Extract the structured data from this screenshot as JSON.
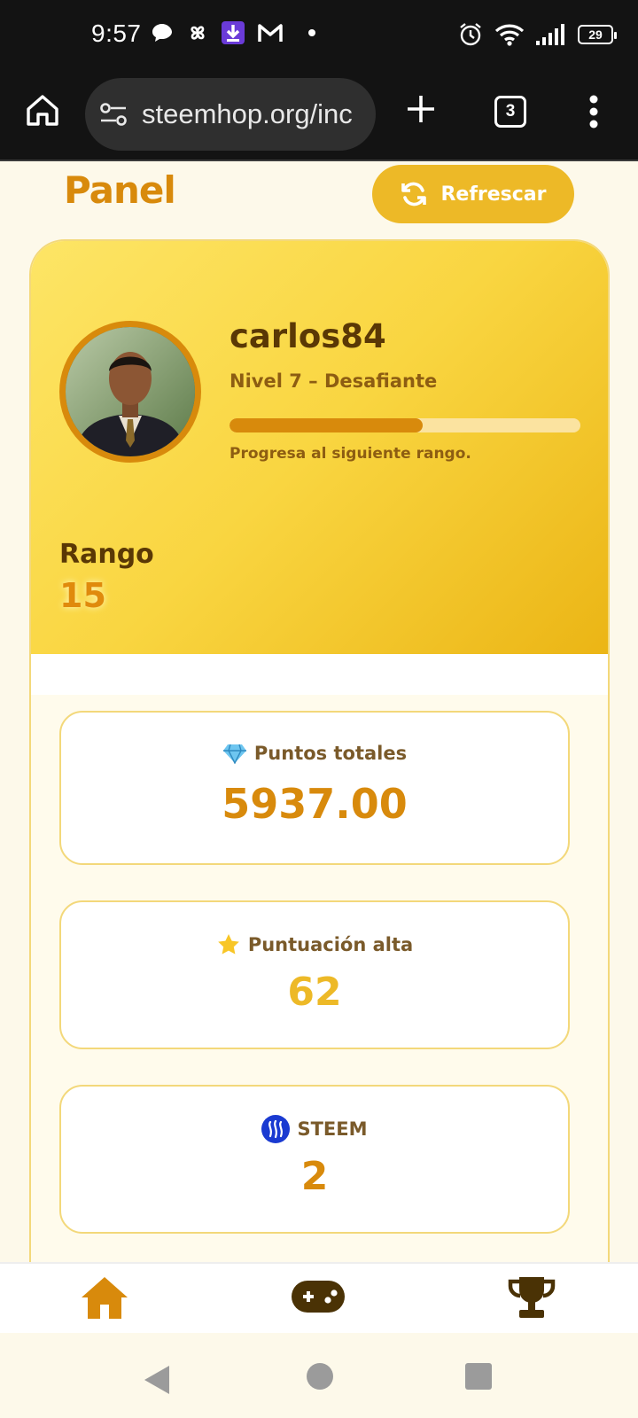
{
  "status_bar": {
    "time": "9:57",
    "battery": "29"
  },
  "browser": {
    "url": "steemhop.org/inc",
    "tab_count": "3"
  },
  "header": {
    "title": "Panel",
    "refresh_label": "Refrescar"
  },
  "profile": {
    "username": "carlos84",
    "level": "Nivel 7 – Desafiante",
    "progress_fraction": 0.55,
    "progress_text": "Progresa al siguiente rango.",
    "rank_label": "Rango",
    "rank_value": "15"
  },
  "stats": [
    {
      "icon": "diamond-icon",
      "label": "Puntos totales",
      "value": "5937.00",
      "color": "#d88a0c"
    },
    {
      "icon": "star-icon",
      "label": "Puntuación alta",
      "value": "62",
      "color": "#edb927"
    },
    {
      "icon": "steem-icon",
      "label": "STEEM",
      "value": "2",
      "color": "#d88a0c"
    }
  ],
  "bottom_nav": [
    "home-icon",
    "gamepad-icon",
    "trophy-icon"
  ],
  "colors": {
    "accent": "#d88a0c",
    "gold": "#edb927",
    "dark_brown": "#5a3805"
  }
}
